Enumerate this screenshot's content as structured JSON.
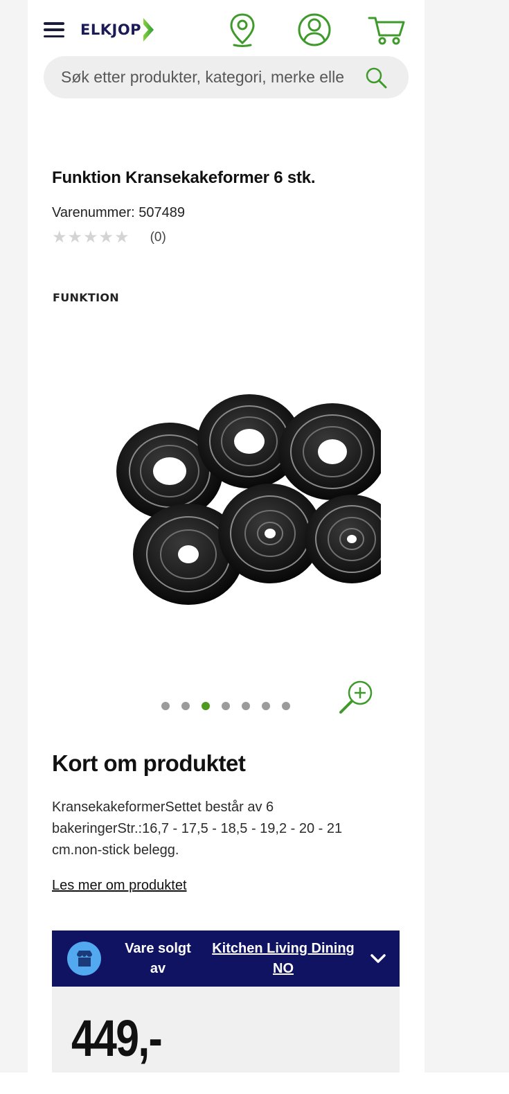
{
  "header": {
    "logo_text": "ELKJOP",
    "icons": [
      "hamburger-menu-icon",
      "store-locator-icon",
      "account-icon",
      "cart-icon"
    ]
  },
  "search": {
    "placeholder": "Søk etter produkter, kategori, merke eller"
  },
  "product": {
    "title": "Funktion Kransekakeformer 6 stk.",
    "sku_label": "Varenummer:",
    "sku_value": "507489",
    "rating_stars": 0,
    "review_count": "(0)",
    "brand": "FUNKTION"
  },
  "gallery": {
    "image_count": 7,
    "active_index": 2
  },
  "about": {
    "heading": "Kort om produktet",
    "description": "KransekakeformerSettet består av 6 bakeringerStr.:16,7 - 17,5 - 18,5 - 19,2 - 20 - 21 cm.non-stick belegg.",
    "read_more": "Les mer om produktet"
  },
  "seller": {
    "label": "Vare solgt av",
    "name": "Kitchen Living Dining NO"
  },
  "price": {
    "value": "449,-"
  },
  "colors": {
    "brand_navy": "#0f1361",
    "accent_green": "#4d9a1e",
    "seller_icon_blue": "#52a9f0"
  }
}
